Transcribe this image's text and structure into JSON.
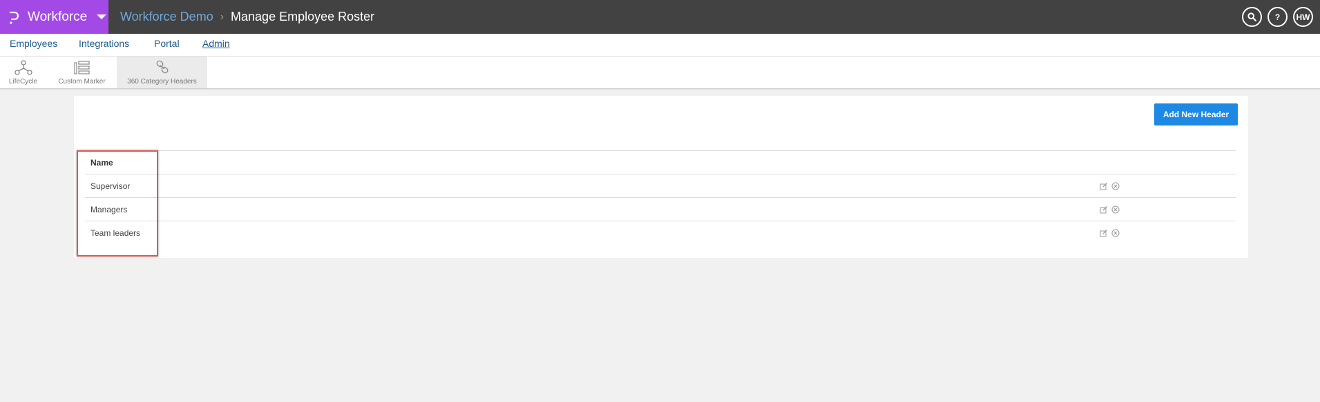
{
  "app": {
    "brand_name": "Workforce",
    "brand_color": "#a349e6",
    "topbar_color": "#424242"
  },
  "breadcrumb": {
    "parent": "Workforce Demo",
    "separator": "›",
    "current": "Manage Employee Roster"
  },
  "top_icons": {
    "search_icon": "search-icon",
    "help_label": "?",
    "user_initials": "HW"
  },
  "nav": {
    "items": [
      {
        "label": "Employees"
      },
      {
        "label": "Integrations"
      },
      {
        "label": "Portal"
      },
      {
        "label": "Admin",
        "active": true
      }
    ]
  },
  "toolbar": {
    "items": [
      {
        "label": "LifeCycle",
        "icon": "lifecycle-icon"
      },
      {
        "label": "Custom Marker",
        "icon": "custom-marker-icon"
      },
      {
        "label": "360 Category Headers",
        "icon": "category-headers-icon",
        "active": true
      }
    ]
  },
  "content": {
    "add_button_label": "Add New Header",
    "accent_color": "#1e88e5",
    "table": {
      "header": "Name",
      "rows": [
        {
          "name": "Supervisor"
        },
        {
          "name": "Managers"
        },
        {
          "name": "Team leaders"
        }
      ]
    }
  },
  "annotation_color": "#e2574c"
}
